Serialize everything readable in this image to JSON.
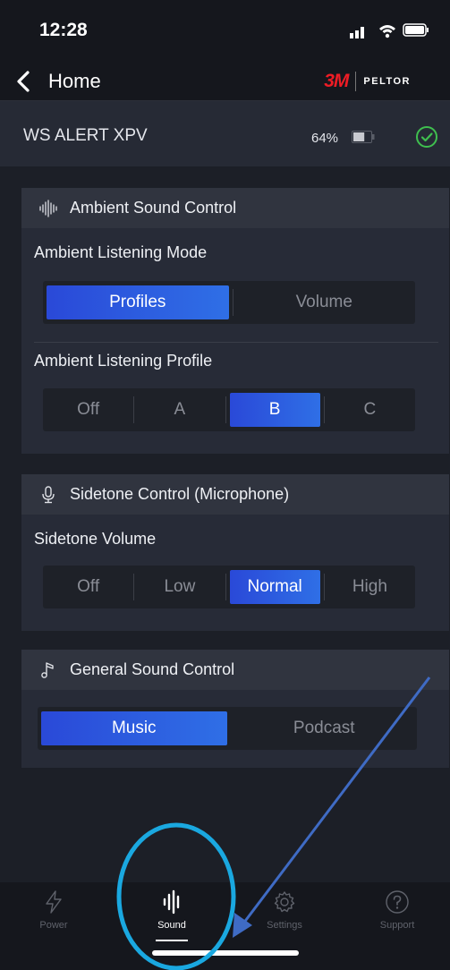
{
  "status_bar": {
    "time": "12:28"
  },
  "nav": {
    "back_label": "Home",
    "brand_3m": "3M",
    "brand_peltor": "PELTOR"
  },
  "device": {
    "name": "WS ALERT XPV",
    "battery_percent": "64%",
    "battery_level": 0.64,
    "connected": true
  },
  "ambient": {
    "title": "Ambient Sound Control",
    "mode_label": "Ambient Listening Mode",
    "mode_options": [
      "Profiles",
      "Volume"
    ],
    "mode_selected": "Profiles",
    "profile_label": "Ambient Listening Profile",
    "profile_options": [
      "Off",
      "A",
      "B",
      "C"
    ],
    "profile_selected": "B"
  },
  "sidetone": {
    "title": "Sidetone Control (Microphone)",
    "volume_label": "Sidetone Volume",
    "volume_options": [
      "Off",
      "Low",
      "Normal",
      "High"
    ],
    "volume_selected": "Normal"
  },
  "general": {
    "title": "General Sound Control",
    "options": [
      "Music",
      "Podcast"
    ],
    "selected": "Music"
  },
  "tabs": [
    {
      "label": "Power",
      "icon": "lightning-icon"
    },
    {
      "label": "Sound",
      "icon": "sound-wave-icon",
      "active": true
    },
    {
      "label": "Settings",
      "icon": "gear-icon"
    },
    {
      "label": "Support",
      "icon": "help-icon"
    }
  ],
  "colors": {
    "accent_blue": "#2a49d8",
    "brand_red": "#ee1c25",
    "check_green": "#3fbf4f",
    "annotation_blue": "#1aa8e0"
  }
}
